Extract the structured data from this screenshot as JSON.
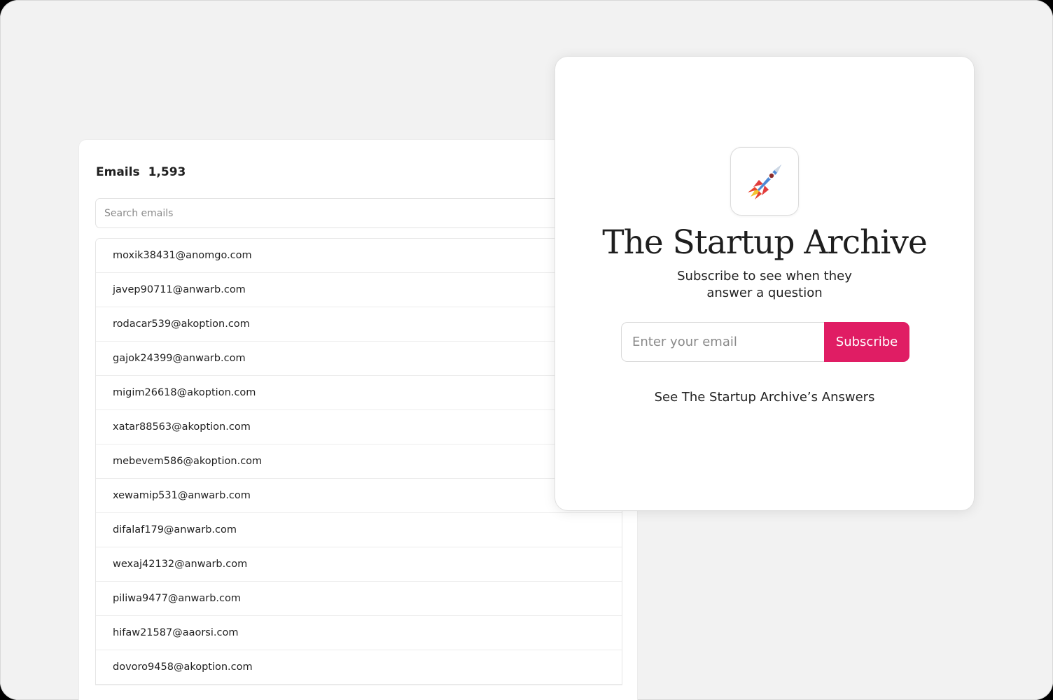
{
  "emails_panel": {
    "title": "Emails",
    "count": "1,593",
    "search_placeholder": "Search emails",
    "emails": [
      "moxik38431@anomgo.com",
      "javep90711@anwarb.com",
      "rodacar539@akoption.com",
      "gajok24399@anwarb.com",
      "migim26618@akoption.com",
      "xatar88563@akoption.com",
      "mebevem586@akoption.com",
      "xewamip531@anwarb.com",
      "difalaf179@anwarb.com",
      "wexaj42132@anwarb.com",
      "piliwa9477@anwarb.com",
      "hifaw21587@aaorsi.com",
      "dovoro9458@akoption.com"
    ]
  },
  "subscribe_card": {
    "logo_icon": "rocket-icon",
    "title": "The Startup Archive",
    "subtitle": "Subscribe to see when they answer a question",
    "email_placeholder": "Enter your email",
    "subscribe_label": "Subscribe",
    "answers_link": "See The Startup Archive’s Answers"
  },
  "colors": {
    "accent": "#e01d64",
    "background": "#f2f2f2"
  }
}
